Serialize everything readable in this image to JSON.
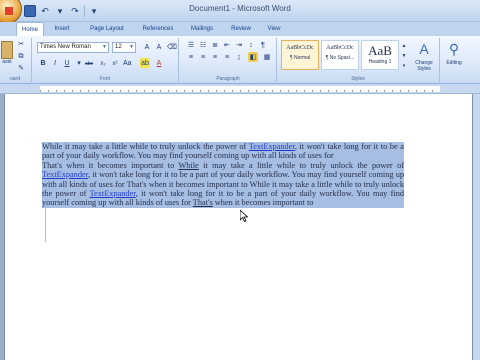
{
  "window": {
    "title": "Document1 - Microsoft Word"
  },
  "tabs": [
    {
      "label": "Home",
      "active": true
    },
    {
      "label": "Insert",
      "active": false
    },
    {
      "label": "Page Layout",
      "active": false
    },
    {
      "label": "References",
      "active": false
    },
    {
      "label": "Mailings",
      "active": false
    },
    {
      "label": "Review",
      "active": false
    },
    {
      "label": "View",
      "active": false
    }
  ],
  "ribbon": {
    "clipboard": {
      "label": "oard",
      "paste_label": "aste"
    },
    "font": {
      "label": "Font",
      "family": "Times New Roman",
      "size": "12"
    },
    "paragraph": {
      "label": "Paragraph"
    },
    "styles": {
      "label": "Styles",
      "items": [
        {
          "preview": "AaBbCcDc",
          "name": "¶ Normal",
          "active": true
        },
        {
          "preview": "AaBbCcDc",
          "name": "¶ No Spaci...",
          "active": false
        },
        {
          "preview": "AaB",
          "name": "Heading 1",
          "active": false
        }
      ],
      "change_styles_label": "Change Styles"
    },
    "editing": {
      "label": "Editing"
    }
  },
  "document": {
    "paragraph1": {
      "pre": "While it may take a little while to truly unlock the power of ",
      "link": "TextExpander",
      "post": ", it won't take long for it to be a part of your daily workflow. You may find yourself coming up with all kinds of uses for"
    },
    "paragraph2": {
      "a": "That's when it becomes important to ",
      "b": "While",
      "c": " it may take a little while to truly unlock the power of ",
      "d": "TextExpander",
      "e": ", it won't take long for it to be a part of your daily workflow. You may find yourself coming up with all kinds of uses for That's when it becomes important to While it may take a little while to truly unlock the power of ",
      "f": "TextExpander",
      "g": ", it won't take long for it to be a part of your daily workflow. You may find yourself coming up with all kinds of uses for ",
      "h": "That's",
      "i": " when it becomes important to"
    }
  }
}
